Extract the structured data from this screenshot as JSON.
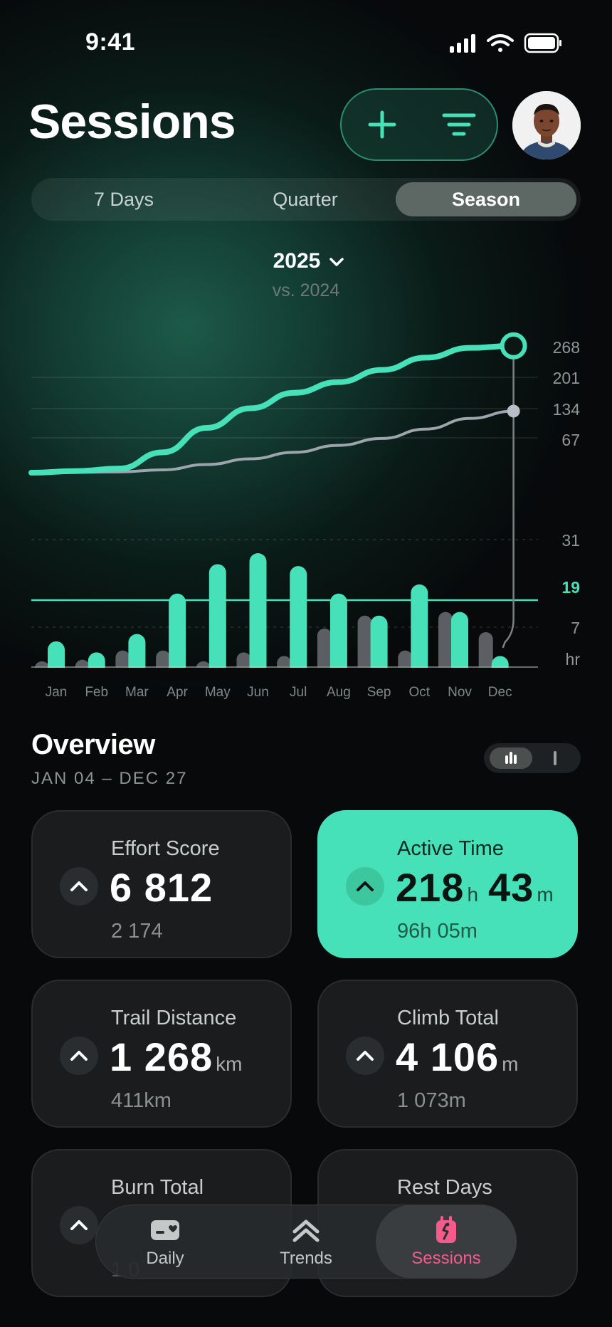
{
  "status": {
    "time": "9:41"
  },
  "header": {
    "title": "Sessions"
  },
  "segments": [
    "7 Days",
    "Quarter",
    "Season"
  ],
  "active_segment": "Season",
  "year": {
    "label": "2025",
    "compare": "vs. 2024"
  },
  "chart_data": {
    "type": "line+bar",
    "categories": [
      "Jan",
      "Feb",
      "Mar",
      "Apr",
      "May",
      "Jun",
      "Jul",
      "Aug",
      "Sep",
      "Oct",
      "Nov",
      "Dec"
    ],
    "cumulative": {
      "axis_ticks": [
        "268",
        "201",
        "134",
        "67"
      ],
      "series": [
        {
          "values": [
            0,
            4,
            10,
            50,
            110,
            158,
            196,
            222,
            252,
            282,
            306,
            311
          ]
        },
        {
          "values": [
            0,
            1,
            2,
            7,
            20,
            34,
            50,
            67,
            84,
            107,
            133,
            151
          ]
        }
      ]
    },
    "monthly": {
      "axis_ticks": [
        "31",
        "19",
        "7",
        "hr"
      ],
      "reference_line": 19,
      "series": [
        {
          "values": [
            7,
            4,
            9,
            20,
            28,
            31,
            27.5,
            20,
            14,
            22.5,
            15,
            3
          ]
        },
        {
          "values": [
            1,
            2,
            4.5,
            4.5,
            1.5,
            4,
            3,
            10.5,
            14,
            4.5,
            15,
            9.5
          ]
        }
      ]
    },
    "colors": {
      "current": "#46e1b8",
      "previous": "#9ea4ae",
      "previous_bar": "#5b5f63"
    }
  },
  "overview": {
    "title": "Overview",
    "range": "JAN 04 – DEC 27",
    "cards": [
      {
        "label": "Effort Score",
        "value": "6 812",
        "unit": "",
        "sub": "2 174"
      },
      {
        "label": "Active Time",
        "value": "218",
        "unit": "h",
        "value2": "43",
        "unit2": "m",
        "sub": "96h 05m",
        "highlight": true
      },
      {
        "label": "Trail Distance",
        "value": "1 268",
        "unit": "km",
        "sub": "411km"
      },
      {
        "label": "Climb Total",
        "value": "4 106",
        "unit": "m",
        "sub": "1 073m"
      },
      {
        "label": "Burn Total",
        "value": "",
        "unit": "",
        "sub": "1 0"
      },
      {
        "label": "Rest Days",
        "value": "",
        "unit": "",
        "sub": ""
      }
    ]
  },
  "tabs": [
    {
      "label": "Daily",
      "icon": "daily-card-icon"
    },
    {
      "label": "Trends",
      "icon": "double-chevron-up-icon"
    },
    {
      "label": "Sessions",
      "icon": "sessions-icon",
      "active": true
    }
  ]
}
